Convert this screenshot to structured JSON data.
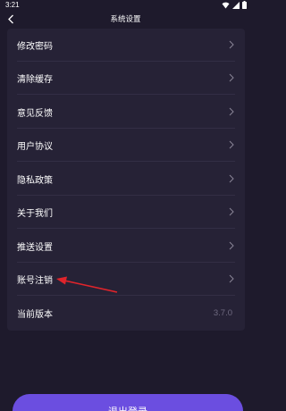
{
  "status_bar": {
    "time": "3:21",
    "icons": [
      "wifi-icon",
      "signal-icon",
      "battery-icon"
    ]
  },
  "header": {
    "title": "系统设置"
  },
  "settings": {
    "items": [
      {
        "label": "修改密码",
        "type": "link"
      },
      {
        "label": "清除缓存",
        "type": "link"
      },
      {
        "label": "意见反馈",
        "type": "link"
      },
      {
        "label": "用户协议",
        "type": "link"
      },
      {
        "label": "隐私政策",
        "type": "link"
      },
      {
        "label": "关于我们",
        "type": "link"
      },
      {
        "label": "推送设置",
        "type": "link"
      },
      {
        "label": "账号注销",
        "type": "link"
      },
      {
        "label": "当前版本",
        "type": "value",
        "value": "3.7.0"
      }
    ]
  },
  "logout": {
    "label": "退出登录"
  },
  "colors": {
    "background": "#1e1a2c",
    "card": "#262236",
    "accent": "#6b4ee0",
    "annotation": "#e0242b"
  }
}
